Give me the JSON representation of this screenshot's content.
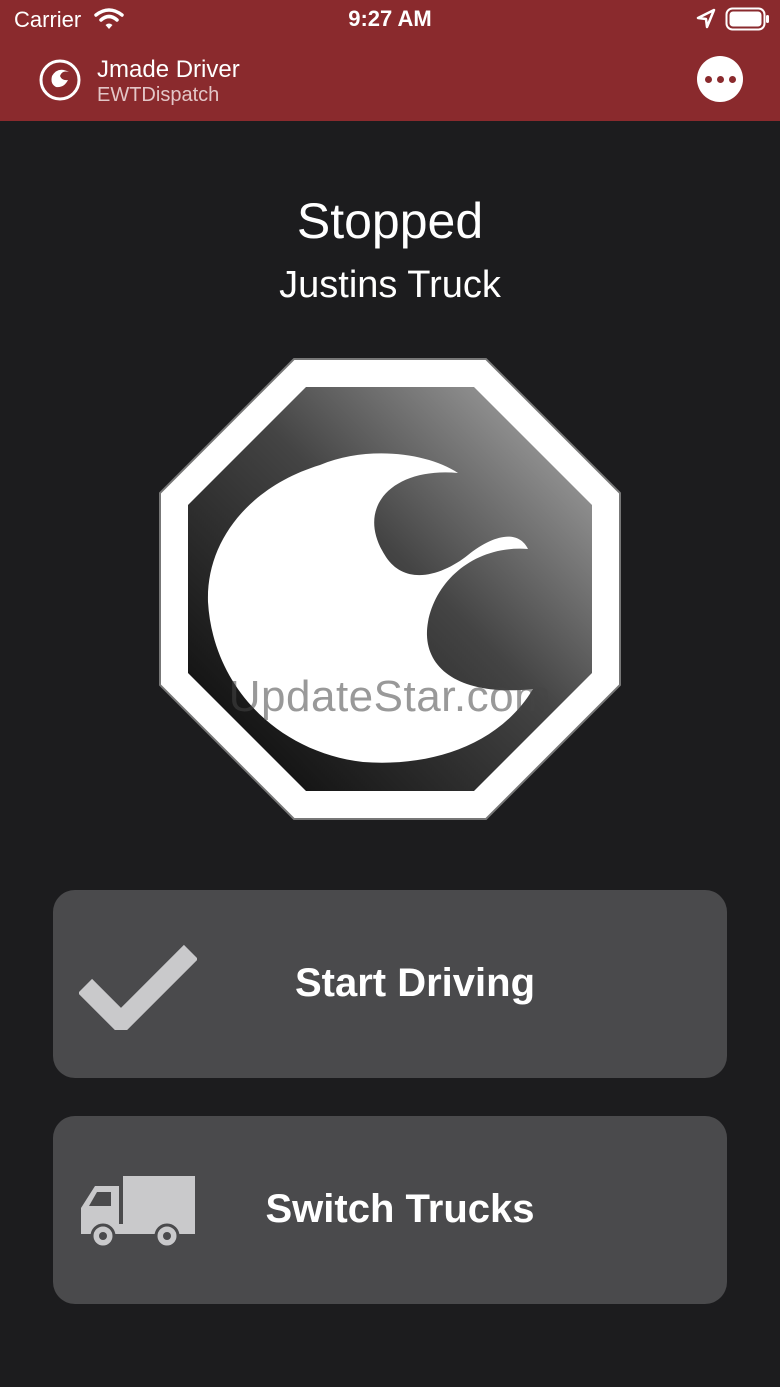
{
  "status_bar": {
    "carrier": "Carrier",
    "time": "9:27 AM"
  },
  "header": {
    "title": "Jmade Driver",
    "subtitle": "EWTDispatch",
    "logo_icon": "jmade-wave-icon",
    "menu_icon": "more-options-icon"
  },
  "main": {
    "status": "Stopped",
    "truck_name": "Justins Truck",
    "sign_icon": "stop-sign-wave-icon",
    "watermark": "UpdateStar.com"
  },
  "actions": [
    {
      "label": "Start Driving",
      "icon": "checkmark-icon"
    },
    {
      "label": "Switch Trucks",
      "icon": "truck-icon"
    }
  ],
  "colors": {
    "header": "#8a2a2d",
    "background": "#1c1c1e",
    "button": "#4a4a4c"
  }
}
